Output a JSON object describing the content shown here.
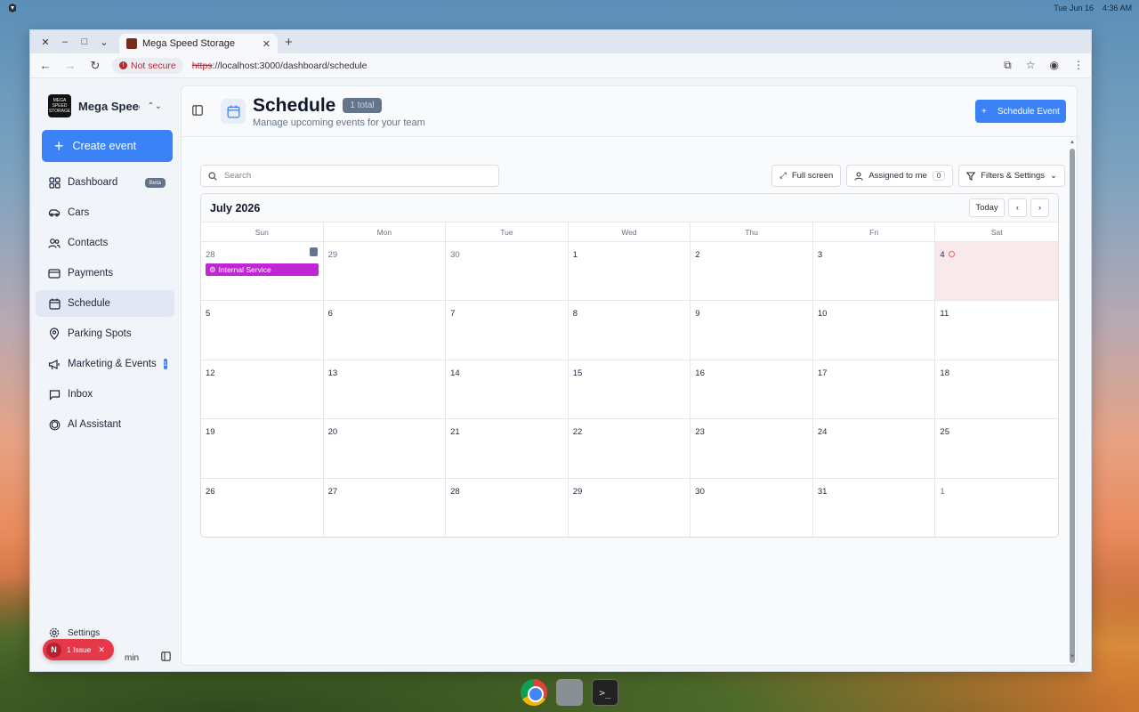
{
  "os": {
    "date": "Tue Jun 16",
    "time": "4:36 AM"
  },
  "browser": {
    "tab_title": "Mega Speed Storage",
    "security_label": "Not secure",
    "url_scheme": "https",
    "url_rest": "://localhost:3000/dashboard/schedule"
  },
  "sidebar": {
    "brand_name": "Mega Speed...",
    "brand_logo_text": "MEGA SPEED STORAGE",
    "create_label": "Create event",
    "items": [
      {
        "label": "Dashboard",
        "icon": "grid-icon",
        "badge": "Beta"
      },
      {
        "label": "Cars",
        "icon": "car-icon"
      },
      {
        "label": "Contacts",
        "icon": "users-icon"
      },
      {
        "label": "Payments",
        "icon": "card-icon"
      },
      {
        "label": "Schedule",
        "icon": "calendar-icon",
        "active": true
      },
      {
        "label": "Parking Spots",
        "icon": "pin-icon"
      },
      {
        "label": "Marketing & Events",
        "icon": "megaphone-icon",
        "count": "1"
      },
      {
        "label": "Inbox",
        "icon": "chat-icon"
      },
      {
        "label": "AI Assistant",
        "icon": "openai-icon"
      }
    ],
    "settings_label": "Settings",
    "user_label": "min",
    "issue": {
      "letter": "N",
      "label": "1 Issue"
    }
  },
  "header": {
    "title": "Schedule",
    "total_badge": "1 total",
    "subtitle": "Manage upcoming events for your team",
    "schedule_button": "Schedule Event"
  },
  "toolbar": {
    "search_placeholder": "Search",
    "fullscreen_label": "Full screen",
    "assigned_label": "Assigned to me",
    "assigned_count": "0",
    "filters_label": "Filters & Settings"
  },
  "calendar": {
    "month_label": "July 2026",
    "today_label": "Today",
    "weekdays": [
      "Sun",
      "Mon",
      "Tue",
      "Wed",
      "Thu",
      "Fri",
      "Sat"
    ],
    "days": [
      "28",
      "29",
      "30",
      "1",
      "2",
      "3",
      "4",
      "5",
      "6",
      "7",
      "8",
      "9",
      "10",
      "11",
      "12",
      "13",
      "14",
      "15",
      "16",
      "17",
      "18",
      "19",
      "20",
      "21",
      "22",
      "23",
      "24",
      "25",
      "26",
      "27",
      "28",
      "29",
      "30",
      "31",
      "1"
    ],
    "other_month_indices": [
      0,
      1,
      2,
      34
    ],
    "today_index": 6,
    "events": [
      {
        "day_index": 0,
        "label": "Internal Service",
        "color": "#c026d3"
      }
    ]
  },
  "colors": {
    "accent": "#3b82f6",
    "event": "#c026d3",
    "issue": "#e5394a"
  }
}
